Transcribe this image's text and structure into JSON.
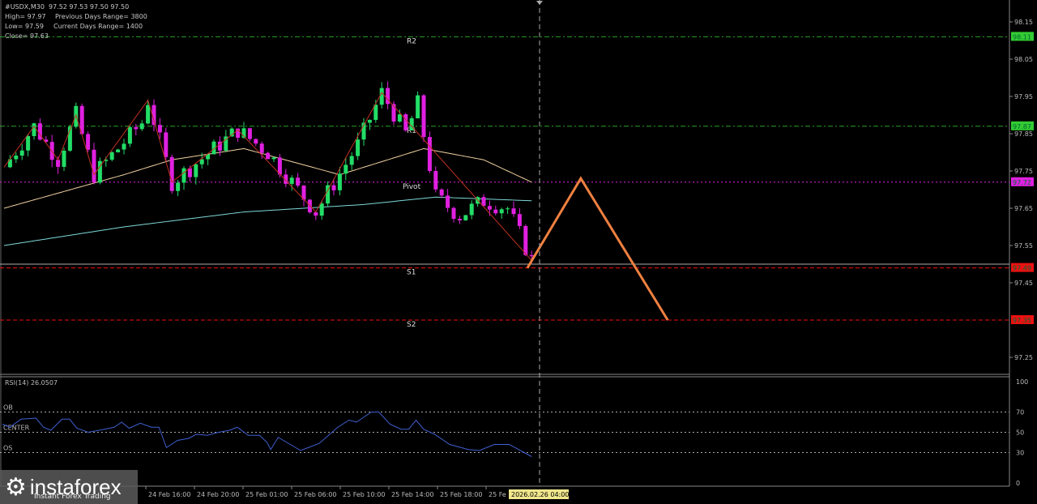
{
  "header": {
    "symbol_line": "#USDX,M30  97.52 97.53 97.50 97.50",
    "high": "High= 97.97",
    "prev_range": "Previous Days Range= 3800",
    "low": "Low= 97.59",
    "cur_range": "Current Days Range= 1400",
    "close": "Close= 97.63"
  },
  "levels": [
    {
      "name": "R2",
      "price": 98.11,
      "label": "98.11",
      "color": "#33cc33",
      "style": "dashdot"
    },
    {
      "name": "R1",
      "price": 97.87,
      "label": "97.87",
      "color": "#33cc33",
      "style": "dashdot"
    },
    {
      "name": "Pivot",
      "price": 97.72,
      "label": "97.72",
      "color": "#e020e0",
      "style": "dot"
    },
    {
      "name": "S1",
      "price": 97.49,
      "label": "97.49",
      "color": "#ee1111",
      "style": "dash"
    },
    {
      "name": "S2",
      "price": 97.35,
      "label": "97.35",
      "color": "#ee1111",
      "style": "dash"
    }
  ],
  "current_price": {
    "value": 97.5,
    "label": "97.50"
  },
  "colors": {
    "bull": "#22dd66",
    "bear": "#e020e0",
    "ma_slow": "#f0d0a0",
    "ma_fast": "#7fd8d8",
    "forecast": "#f08040",
    "zigzag": "#c03020",
    "rsi": "#4060d0"
  },
  "chart_data": {
    "type": "candlestick",
    "title": "#USDX,M30",
    "y_ticks": [
      98.15,
      98.05,
      97.95,
      97.85,
      97.75,
      97.65,
      97.55,
      97.45,
      97.25
    ],
    "ylim": [
      97.17,
      98.21
    ],
    "price_path": [
      [
        0,
        97.76
      ],
      [
        5,
        97.87
      ],
      [
        9,
        97.78
      ],
      [
        12,
        97.9
      ],
      [
        15,
        97.74
      ],
      [
        23,
        97.88
      ],
      [
        24,
        97.94
      ],
      [
        28,
        97.72
      ],
      [
        39,
        97.86
      ],
      [
        44,
        97.8
      ],
      [
        52,
        97.64
      ],
      [
        59,
        97.82
      ],
      [
        63,
        97.96
      ],
      [
        67,
        97.85
      ],
      [
        69,
        97.93
      ],
      [
        72,
        97.68
      ],
      [
        76,
        97.63
      ],
      [
        80,
        97.67
      ],
      [
        84,
        97.65
      ],
      [
        88,
        97.51
      ]
    ],
    "ma_slow": [
      [
        0,
        97.65
      ],
      [
        20,
        97.74
      ],
      [
        28,
        97.78
      ],
      [
        40,
        97.81
      ],
      [
        56,
        97.74
      ],
      [
        70,
        97.81
      ],
      [
        80,
        97.78
      ],
      [
        88,
        97.72
      ]
    ],
    "ma_fast": [
      [
        0,
        97.55
      ],
      [
        20,
        97.6
      ],
      [
        40,
        97.64
      ],
      [
        60,
        97.66
      ],
      [
        72,
        97.68
      ],
      [
        88,
        97.67
      ]
    ],
    "forecast": [
      [
        87.3,
        97.49
      ],
      [
        96.2,
        97.73
      ],
      [
        110.7,
        97.35
      ]
    ],
    "x_labels": [
      "24 Feb 16:00",
      "24 Feb 20:00",
      "25 Feb 01:00",
      "25 Feb 06:00",
      "25 Feb 10:00",
      "25 Feb 14:00",
      "25 Feb 18:00",
      "25 Fe"
    ],
    "current_time": "2026.02.26 04:00",
    "rsi": {
      "label": "RSI(14) 26.0507",
      "levels": [
        {
          "name": "OB",
          "value": 70
        },
        {
          "name": "CENTER",
          "value": 50
        },
        {
          "name": "OS",
          "value": 30
        }
      ],
      "axis": [
        "100",
        "70",
        "50",
        "30",
        "0"
      ],
      "values": [
        [
          0,
          58
        ],
        [
          2,
          55
        ],
        [
          5,
          63
        ],
        [
          9,
          64
        ],
        [
          11,
          55
        ],
        [
          13,
          52
        ],
        [
          16,
          63
        ],
        [
          18,
          63
        ],
        [
          20,
          54
        ],
        [
          23,
          50
        ],
        [
          26,
          52
        ],
        [
          30,
          55
        ],
        [
          32,
          60
        ],
        [
          34,
          54
        ],
        [
          37,
          59
        ],
        [
          40,
          55
        ],
        [
          42,
          55
        ],
        [
          44,
          35
        ],
        [
          47,
          42
        ],
        [
          50,
          44
        ],
        [
          52,
          48
        ],
        [
          55,
          47
        ],
        [
          58,
          50
        ],
        [
          61,
          52
        ],
        [
          63,
          55
        ],
        [
          66,
          47
        ],
        [
          69,
          47
        ],
        [
          71,
          40
        ],
        [
          72,
          33
        ],
        [
          74,
          45
        ],
        [
          80,
          32
        ],
        [
          85,
          39
        ],
        [
          90,
          55
        ],
        [
          93,
          62
        ],
        [
          95,
          60
        ],
        [
          99,
          70
        ],
        [
          101,
          70
        ],
        [
          104,
          58
        ],
        [
          107,
          53
        ],
        [
          109,
          53
        ],
        [
          111,
          62
        ],
        [
          113,
          53
        ],
        [
          116,
          48
        ],
        [
          120,
          38
        ],
        [
          125,
          33
        ],
        [
          128,
          32
        ],
        [
          132,
          38
        ],
        [
          136,
          38
        ],
        [
          140,
          30
        ],
        [
          142,
          26
        ]
      ]
    }
  },
  "brand": {
    "name": "instaforex",
    "tagline": "Instant Forex Trading"
  }
}
